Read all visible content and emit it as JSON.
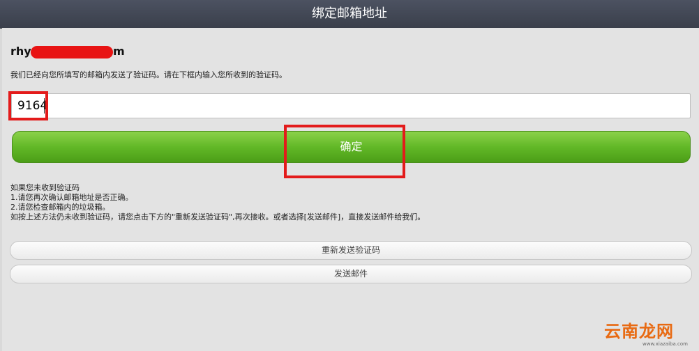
{
  "header": {
    "title": "绑定邮箱地址"
  },
  "email": {
    "prefix": "rhy",
    "suffix": "m"
  },
  "info": {
    "message": "我们已经向您所填写的邮箱内发送了验证码。请在下框内输入您所收到的验证码。"
  },
  "code_input": {
    "value": "9164"
  },
  "confirm_button": {
    "label": "确定"
  },
  "help": {
    "lines": [
      "如果您未收到验证码",
      "1.请您再次确认邮箱地址是否正确。",
      "2.请您检查邮箱内的垃圾箱。",
      "如按上述方法仍未收到验证码，请您点击下方的\"重新发送验证码\",再次接收。或者选择[发送邮件]，直接发送邮件给我们。"
    ]
  },
  "resend_button": {
    "label": "重新发送验证码"
  },
  "send_mail_button": {
    "label": "发送邮件"
  },
  "watermark": {
    "brand": "云南龙网",
    "url": "www.xiazaiba.com"
  },
  "colors": {
    "highlight": "#e31b1b",
    "confirm_green": "#62b827",
    "title_bar": "#444955"
  }
}
